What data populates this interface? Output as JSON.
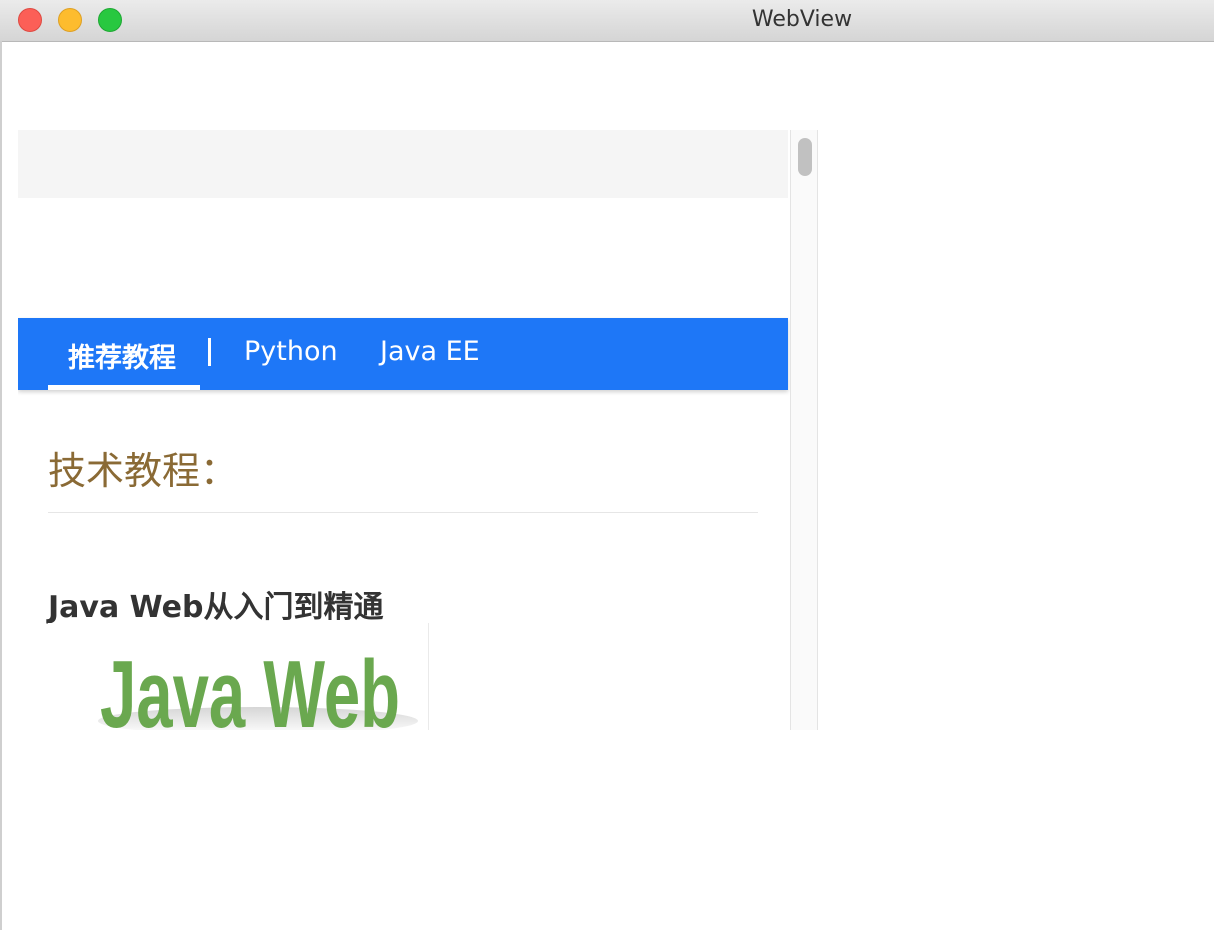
{
  "window": {
    "title": "WebView"
  },
  "nav": {
    "items": [
      {
        "label": "推荐教程",
        "active": true
      },
      {
        "label": "Python",
        "active": false
      },
      {
        "label": "Java EE",
        "active": false
      }
    ],
    "separator": "|"
  },
  "content": {
    "section_title": "技术教程：",
    "article": {
      "title": "Java Web从入门到精通",
      "image_logo_text": "Java Web"
    }
  },
  "colors": {
    "nav_background": "#1e77f7",
    "section_title": "#8a6a35",
    "logo_green": "#6aa84f"
  }
}
